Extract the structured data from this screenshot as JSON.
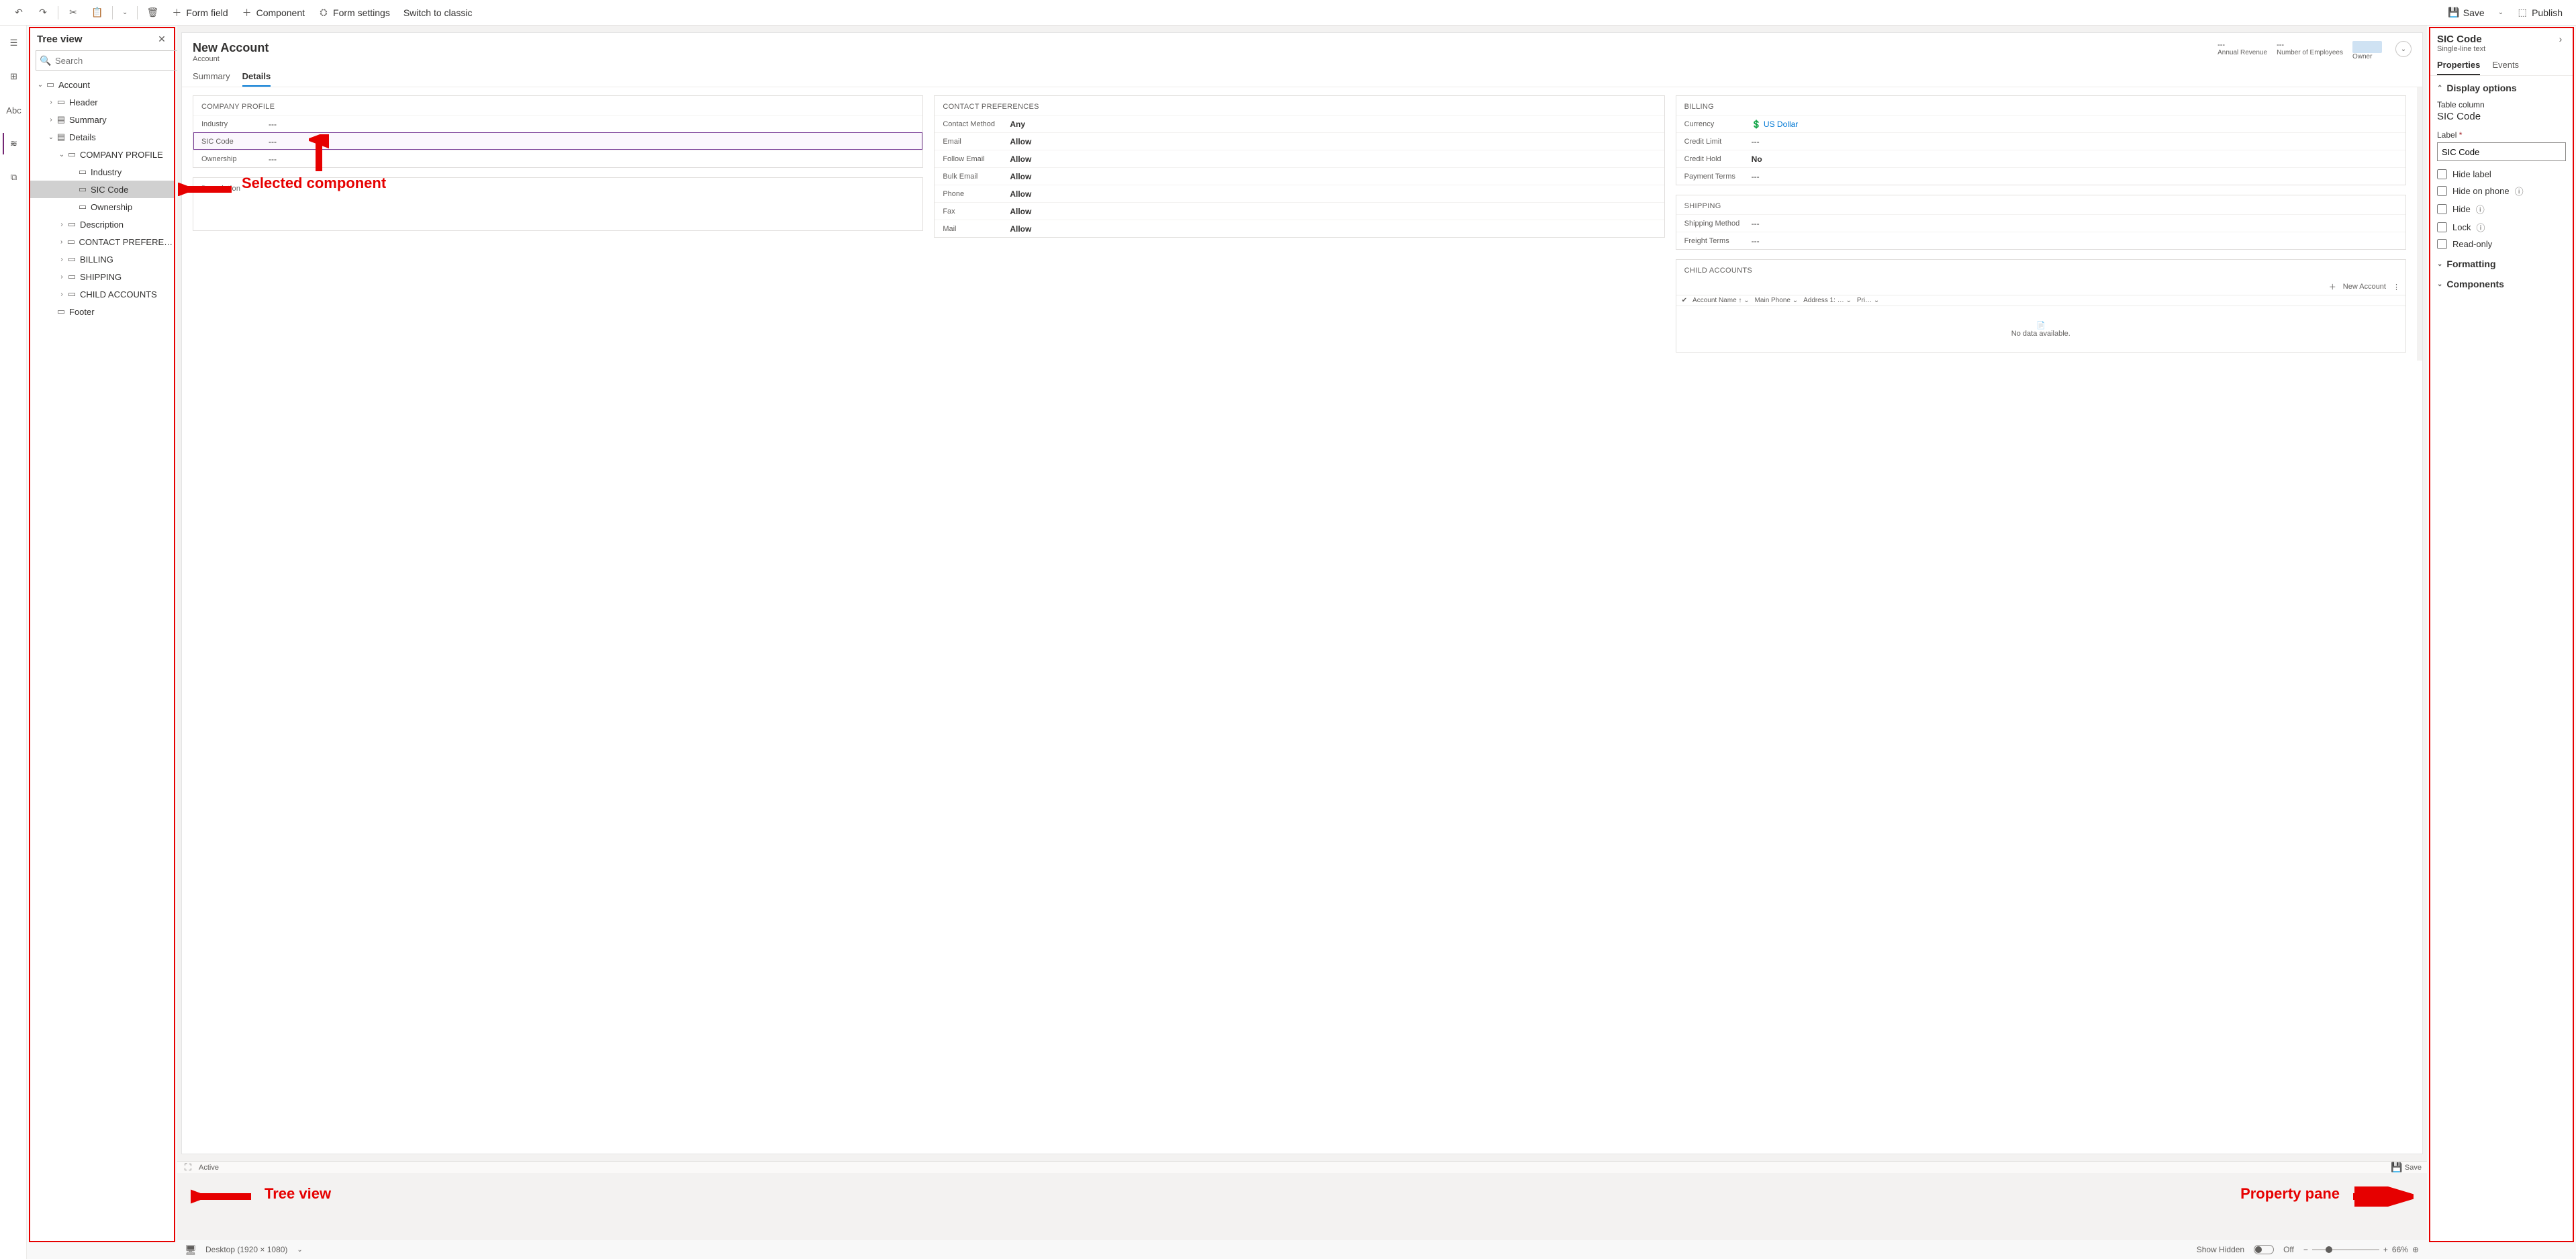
{
  "toolbar": {
    "form_field": "Form field",
    "component": "Component",
    "form_settings": "Form settings",
    "switch_classic": "Switch to classic",
    "save": "Save",
    "publish": "Publish"
  },
  "tree": {
    "title": "Tree view",
    "search_placeholder": "Search",
    "items": [
      {
        "depth": 0,
        "twist": "v",
        "icon": "▭",
        "label": "Account"
      },
      {
        "depth": 1,
        "twist": ">",
        "icon": "▭",
        "label": "Header"
      },
      {
        "depth": 1,
        "twist": ">",
        "icon": "▤",
        "label": "Summary"
      },
      {
        "depth": 1,
        "twist": "v",
        "icon": "▤",
        "label": "Details"
      },
      {
        "depth": 2,
        "twist": "v",
        "icon": "▭",
        "label": "COMPANY PROFILE"
      },
      {
        "depth": 3,
        "twist": "",
        "icon": "▭",
        "label": "Industry"
      },
      {
        "depth": 3,
        "twist": "",
        "icon": "▭",
        "label": "SIC Code",
        "selected": true
      },
      {
        "depth": 3,
        "twist": "",
        "icon": "▭",
        "label": "Ownership"
      },
      {
        "depth": 2,
        "twist": ">",
        "icon": "▭",
        "label": "Description"
      },
      {
        "depth": 2,
        "twist": ">",
        "icon": "▭",
        "label": "CONTACT PREFEREN…"
      },
      {
        "depth": 2,
        "twist": ">",
        "icon": "▭",
        "label": "BILLING"
      },
      {
        "depth": 2,
        "twist": ">",
        "icon": "▭",
        "label": "SHIPPING"
      },
      {
        "depth": 2,
        "twist": ">",
        "icon": "▭",
        "label": "CHILD ACCOUNTS"
      },
      {
        "depth": 1,
        "twist": "",
        "icon": "▭",
        "label": "Footer"
      }
    ]
  },
  "form": {
    "title": "New Account",
    "entity": "Account",
    "header_stats": [
      {
        "value": "---",
        "label": "Annual Revenue"
      },
      {
        "value": "---",
        "label": "Number of Employees"
      },
      {
        "value": "",
        "label": "Owner"
      }
    ],
    "tabs": [
      "Summary",
      "Details"
    ],
    "active_tab": 1,
    "sections": {
      "company_profile": {
        "title": "COMPANY PROFILE",
        "fields": [
          {
            "label": "Industry",
            "value": "---"
          },
          {
            "label": "SIC Code",
            "value": "---",
            "selected": true
          },
          {
            "label": "Ownership",
            "value": "---"
          }
        ]
      },
      "description": {
        "title": "Description"
      },
      "contact_prefs": {
        "title": "CONTACT PREFERENCES",
        "fields": [
          {
            "label": "Contact Method",
            "value": "Any",
            "bold": true
          },
          {
            "label": "Email",
            "value": "Allow",
            "bold": true
          },
          {
            "label": "Follow Email",
            "value": "Allow",
            "bold": true
          },
          {
            "label": "Bulk Email",
            "value": "Allow",
            "bold": true
          },
          {
            "label": "Phone",
            "value": "Allow",
            "bold": true
          },
          {
            "label": "Fax",
            "value": "Allow",
            "bold": true
          },
          {
            "label": "Mail",
            "value": "Allow",
            "bold": true
          }
        ]
      },
      "billing": {
        "title": "BILLING",
        "fields": [
          {
            "label": "Currency",
            "value": "US Dollar",
            "currency": true
          },
          {
            "label": "Credit Limit",
            "value": "---"
          },
          {
            "label": "Credit Hold",
            "value": "No",
            "bold": true
          },
          {
            "label": "Payment Terms",
            "value": "---"
          }
        ]
      },
      "shipping": {
        "title": "SHIPPING",
        "fields": [
          {
            "label": "Shipping Method",
            "value": "---"
          },
          {
            "label": "Freight Terms",
            "value": "---"
          }
        ]
      },
      "child_accounts": {
        "title": "CHILD ACCOUNTS",
        "new_label": "New Account",
        "cols": [
          "Account Name ↑",
          "Main Phone",
          "Address 1: …",
          "Pri…"
        ],
        "empty": "No data available."
      }
    }
  },
  "statusbar": {
    "active": "Active",
    "save": "Save"
  },
  "bottombar": {
    "device": "Desktop (1920 × 1080)",
    "show_hidden": "Show Hidden",
    "off": "Off",
    "zoom": "66%"
  },
  "props": {
    "title": "SIC Code",
    "subtitle": "Single-line text",
    "tabs": [
      "Properties",
      "Events"
    ],
    "active_tab": 0,
    "display_options": "Display options",
    "table_column_lab": "Table column",
    "table_column_val": "SIC Code",
    "label_lab": "Label",
    "label_val": "SIC Code",
    "checks": [
      {
        "label": "Hide label",
        "info": false
      },
      {
        "label": "Hide on phone",
        "info": true
      },
      {
        "label": "Hide",
        "info": true
      },
      {
        "label": "Lock",
        "info": true
      },
      {
        "label": "Read-only",
        "info": false
      }
    ],
    "formatting": "Formatting",
    "components": "Components"
  },
  "annotations": {
    "tree_view": "Tree view",
    "selected_component": "Selected component",
    "property_pane": "Property pane"
  }
}
